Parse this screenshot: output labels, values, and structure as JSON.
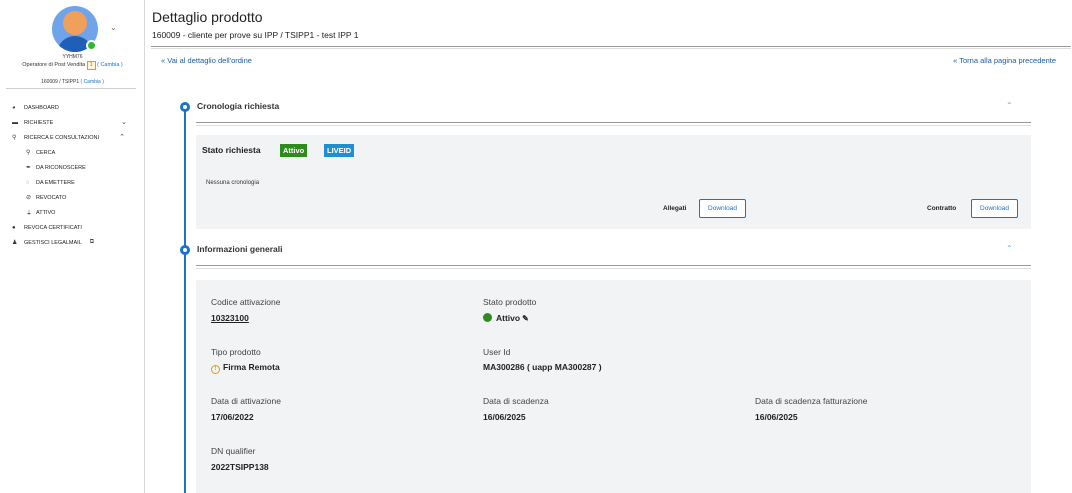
{
  "sidebar": {
    "user_name": "YYHM76",
    "role_text": "Operatore di Post Vendita",
    "role_badge": "1",
    "role_change": "( Cambia )",
    "client_text": "160009 / TSIPP1",
    "client_change": "( Cambia )",
    "items": [
      {
        "label": "DASHBOARD",
        "icon": "speedometer-icon"
      },
      {
        "label": "RICHIESTE",
        "icon": "briefcase-icon"
      },
      {
        "label": "RICERCA E CONSULTAZIONI",
        "icon": "search-icon"
      },
      {
        "label": "CERCA",
        "icon": "search-icon"
      },
      {
        "label": "DA RICONOSCERE",
        "icon": "pen-icon"
      },
      {
        "label": "DA EMETTERE",
        "icon": "spinner-icon"
      },
      {
        "label": "REVOCATO",
        "icon": "ban-icon"
      },
      {
        "label": "ATTIVO",
        "icon": "plug-icon"
      },
      {
        "label": "REVOCA CERTIFICATI",
        "icon": "circle-icon"
      },
      {
        "label": "GESTISCI LEGALMAIL",
        "icon": "users-icon"
      }
    ]
  },
  "header": {
    "title": "Dettaglio prodotto",
    "subtitle": "160009 - cliente per prove su IPP  / TSIPP1 - test IPP 1",
    "link_order": "« Vai al dettaglio dell'ordine",
    "link_back": "« Torna alla pagina precedente"
  },
  "history": {
    "title": "Cronologia richiesta",
    "status_label": "Stato richiesta",
    "badge_active": "Attivo",
    "badge_liveid": "LIVEID",
    "empty_text": "Nessuna cronologia",
    "attachments_label": "Allegati",
    "contract_label": "Contratto",
    "download_label": "Download"
  },
  "info": {
    "title": "Informazioni generali",
    "codice_label": "Codice attivazione",
    "codice_value": "10323100",
    "stato_label": "Stato prodotto",
    "stato_value": "Attivo",
    "tipo_label": "Tipo prodotto",
    "tipo_value": "Firma Remota",
    "user_label": "User Id",
    "user_value": "MA300286 ( uapp MA300287 )",
    "attivazione_label": "Data di attivazione",
    "attivazione_value": "17/06/2022",
    "scadenza_label": "Data di scadenza",
    "scadenza_value": "16/06/2025",
    "fatturazione_label": "Data di scadenza fatturazione",
    "fatturazione_value": "16/06/2025",
    "dn_label": "DN qualifier",
    "dn_value": "2022TSIPP138"
  },
  "colors": {
    "accent": "#1a73c8",
    "active_green": "#2e8b1e",
    "liveid_blue": "#1f8fd0"
  }
}
